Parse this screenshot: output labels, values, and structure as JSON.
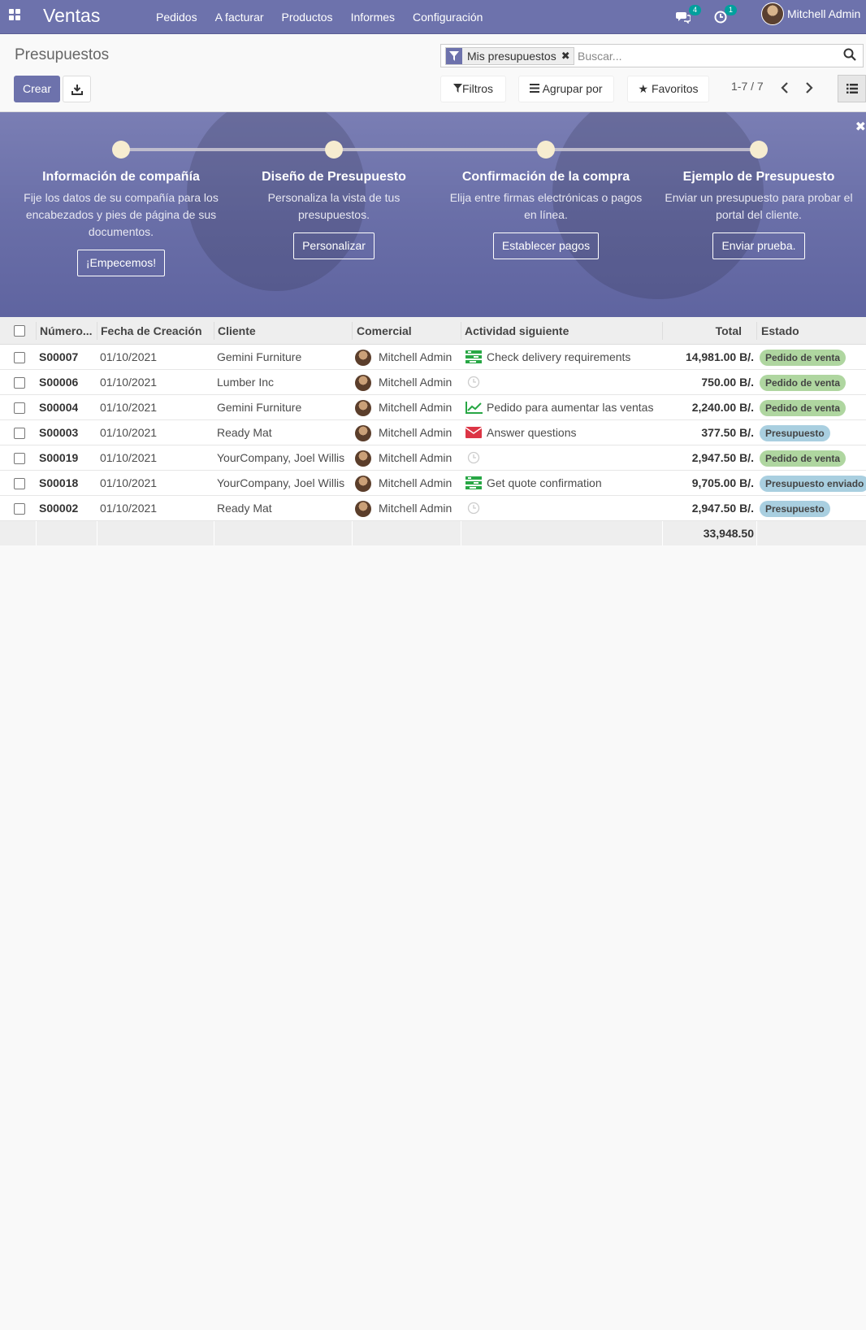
{
  "navbar": {
    "brand": "Ventas",
    "menu": [
      "Pedidos",
      "A facturar",
      "Productos",
      "Informes",
      "Configuración"
    ],
    "messages_count": "4",
    "activities_count": "1",
    "user_name": "Mitchell Admin"
  },
  "control_panel": {
    "title": "Presupuestos",
    "create_label": "Crear",
    "facet_label": "Mis presupuestos",
    "search_placeholder": "Buscar...",
    "filters_label": "Filtros",
    "groupby_label": "Agrupar por",
    "favorites_label": "Favoritos",
    "pager": "1-7 / 7"
  },
  "onboarding": {
    "steps": [
      {
        "title": "Información de compañía",
        "desc": "Fije los datos de su compañía para los encabezados y pies de página de sus documentos.",
        "button": "¡Empecemos!"
      },
      {
        "title": "Diseño de Presupuesto",
        "desc": "Personaliza la vista de tus presupuestos.",
        "button": "Personalizar"
      },
      {
        "title": "Confirmación de la compra",
        "desc": "Elija entre firmas electrónicas o pagos en línea.",
        "button": "Establecer pagos"
      },
      {
        "title": "Ejemplo de Presupuesto",
        "desc": "Enviar un presupuesto para probar el portal del cliente.",
        "button": "Enviar prueba."
      }
    ]
  },
  "table": {
    "columns": [
      "Número...",
      "Fecha de Creación",
      "Cliente",
      "Comercial",
      "Actividad siguiente",
      "Total",
      "Estado"
    ],
    "rows": [
      {
        "number": "S00007",
        "date": "01/10/2021",
        "customer": "Gemini Furniture",
        "salesperson": "Mitchell Admin",
        "activity_icon": "tasks-icon",
        "activity": "Check delivery requirements",
        "total": "14,981.00 B/.",
        "status": "Pedido de venta",
        "status_color": "green"
      },
      {
        "number": "S00006",
        "date": "01/10/2021",
        "customer": "Lumber Inc",
        "salesperson": "Mitchell Admin",
        "activity_icon": "clock-icon",
        "activity": "",
        "total": "750.00 B/.",
        "status": "Pedido de venta",
        "status_color": "green"
      },
      {
        "number": "S00004",
        "date": "01/10/2021",
        "customer": "Gemini Furniture",
        "salesperson": "Mitchell Admin",
        "activity_icon": "line-chart-icon",
        "activity": "Pedido para aumentar las ventas",
        "total": "2,240.00 B/.",
        "status": "Pedido de venta",
        "status_color": "green"
      },
      {
        "number": "S00003",
        "date": "01/10/2021",
        "customer": "Ready Mat",
        "salesperson": "Mitchell Admin",
        "activity_icon": "envelope-icon",
        "activity": "Answer questions",
        "total": "377.50 B/.",
        "status": "Presupuesto",
        "status_color": "blue"
      },
      {
        "number": "S00019",
        "date": "01/10/2021",
        "customer": "YourCompany, Joel Willis",
        "salesperson": "Mitchell Admin",
        "activity_icon": "clock-icon",
        "activity": "",
        "total": "2,947.50 B/.",
        "status": "Pedido de venta",
        "status_color": "green"
      },
      {
        "number": "S00018",
        "date": "01/10/2021",
        "customer": "YourCompany, Joel Willis",
        "salesperson": "Mitchell Admin",
        "activity_icon": "tasks-icon",
        "activity": "Get quote confirmation",
        "total": "9,705.00 B/.",
        "status": "Presupuesto enviado",
        "status_color": "blue"
      },
      {
        "number": "S00002",
        "date": "01/10/2021",
        "customer": "Ready Mat",
        "salesperson": "Mitchell Admin",
        "activity_icon": "clock-icon",
        "activity": "",
        "total": "2,947.50 B/.",
        "status": "Presupuesto",
        "status_color": "blue"
      }
    ],
    "sum_total": "33,948.50"
  },
  "colors": {
    "brand": "#6d72ac",
    "tag_green": "#afd6a0",
    "tag_blue": "#a9cfe0",
    "activity_green": "#28a745",
    "activity_red": "#dc3545"
  }
}
